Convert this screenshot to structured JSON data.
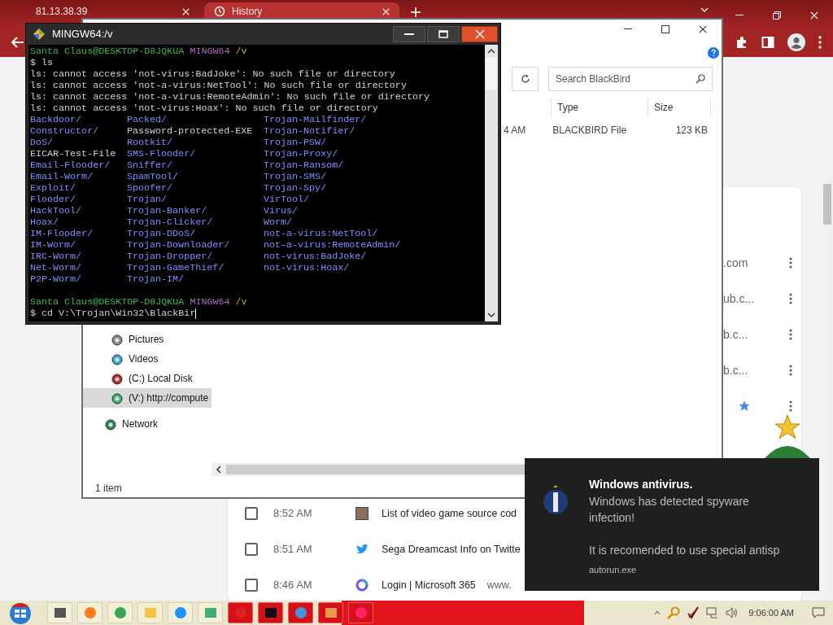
{
  "browser": {
    "tabs": [
      {
        "title": "81.13.38.39",
        "selected": false
      },
      {
        "title": "History",
        "selected": true
      }
    ],
    "url_fragments": [
      {
        "text": ".com",
        "starred": false
      },
      {
        "text": "ub.c...",
        "starred": false
      },
      {
        "text": "b.c...",
        "starred": false
      },
      {
        "text": "b.c...",
        "starred": false
      },
      {
        "starred": true
      }
    ],
    "history_rows": [
      {
        "time": "8:52 AM",
        "title": "List of video game source cod",
        "checked": false,
        "kind": "thumbnail"
      },
      {
        "time": "8:51 AM",
        "title": "Sega Dreamcast Info on Twitte",
        "checked": false,
        "kind": "bird"
      },
      {
        "time": "8:46 AM",
        "title": "Login | Microsoft 365",
        "url": "www.",
        "checked": false,
        "kind": "ring"
      }
    ]
  },
  "explorer": {
    "search": {
      "placeholder": "Search BlackBird"
    },
    "columns": [
      "Type",
      "Size"
    ],
    "files": [
      {
        "column_1": "4 AM",
        "type": "BLACKBIRD File",
        "size": "123 KB"
      }
    ],
    "nav_items": [
      {
        "label": "Pictures",
        "kind": "pictures",
        "selected": false
      },
      {
        "label": "Videos",
        "kind": "videos",
        "selected": false
      },
      {
        "label": "(C:) Local Disk",
        "kind": "disk",
        "selected": false
      },
      {
        "label": "(V:) http://compute",
        "kind": "network-drive",
        "selected": true
      },
      {
        "label": "Network",
        "kind": "network",
        "selected": false
      }
    ],
    "status_bar": "1 item"
  },
  "terminal": {
    "title": "MINGW64:/v",
    "lines_before": [
      [
        {
          "text": "Santa Claus@DESKTOP-D8JQKUA",
          "kind": "user"
        },
        {
          "text": "MINGW64",
          "kind": "system"
        },
        {
          "text": "/v",
          "kind": "path"
        }
      ],
      [
        {
          "text": "$ ls",
          "kind": "plain"
        }
      ],
      [
        {
          "text": "ls: cannot access 'not-virus:BadJoke': No such file or directory",
          "kind": "plain"
        }
      ],
      [
        {
          "text": "ls: cannot access 'not-a-virus:NetTool': No such file or directory",
          "kind": "plain"
        }
      ],
      [
        {
          "text": "ls: cannot access 'not-a-virus:RemoteAdmin': No such file or directory",
          "kind": "plain"
        }
      ],
      [
        {
          "text": "ls: cannot access 'not-virus:Hoax': No such file or directory",
          "kind": "plain"
        }
      ]
    ],
    "listing": [
      [
        {
          "name": "Backdoor/",
          "kind": "dir"
        },
        {
          "name": "Constructor/",
          "kind": "dir"
        },
        {
          "name": "DoS/",
          "kind": "dir"
        },
        {
          "name": "EICAR-Test-File",
          "kind": "file"
        },
        {
          "name": "Email-Flooder/",
          "kind": "dir"
        },
        {
          "name": "Email-Worm/",
          "kind": "dir"
        },
        {
          "name": "Exploit/",
          "kind": "dir"
        },
        {
          "name": "Flooder/",
          "kind": "dir"
        },
        {
          "name": "HackTool/",
          "kind": "dir"
        },
        {
          "name": "Hoax/",
          "kind": "dir"
        },
        {
          "name": "IM-Flooder/",
          "kind": "dir"
        },
        {
          "name": "IM-Worm/",
          "kind": "dir"
        },
        {
          "name": "IRC-Worm/",
          "kind": "dir"
        },
        {
          "name": "Net-Worm/",
          "kind": "dir"
        },
        {
          "name": "P2P-Worm/",
          "kind": "dir"
        }
      ],
      [
        {
          "name": "Packed/",
          "kind": "dir"
        },
        {
          "name": "Password-protected-EXE",
          "kind": "file"
        },
        {
          "name": "Rootkit/",
          "kind": "dir"
        },
        {
          "name": "SMS-Flooder/",
          "kind": "dir"
        },
        {
          "name": "Sniffer/",
          "kind": "dir"
        },
        {
          "name": "SpamTool/",
          "kind": "dir"
        },
        {
          "name": "Spoofer/",
          "kind": "dir"
        },
        {
          "name": "Trojan/",
          "kind": "dir"
        },
        {
          "name": "Trojan-Banker/",
          "kind": "dir"
        },
        {
          "name": "Trojan-Clicker/",
          "kind": "dir"
        },
        {
          "name": "Trojan-DDoS/",
          "kind": "dir"
        },
        {
          "name": "Trojan-Downloader/",
          "kind": "dir"
        },
        {
          "name": "Trojan-Dropper/",
          "kind": "dir"
        },
        {
          "name": "Trojan-GameThief/",
          "kind": "dir"
        },
        {
          "name": "Trojan-IM/",
          "kind": "dir"
        }
      ],
      [
        {
          "name": "Trojan-Mailfinder/",
          "kind": "dir"
        },
        {
          "name": "Trojan-Notifier/",
          "kind": "dir"
        },
        {
          "name": "Trojan-PSW/",
          "kind": "dir"
        },
        {
          "name": "Trojan-Proxy/",
          "kind": "dir"
        },
        {
          "name": "Trojan-Ransom/",
          "kind": "dir"
        },
        {
          "name": "Trojan-SMS/",
          "kind": "dir"
        },
        {
          "name": "Trojan-Spy/",
          "kind": "dir"
        },
        {
          "name": "VirTool/",
          "kind": "dir"
        },
        {
          "name": "Virus/",
          "kind": "dir"
        },
        {
          "name": "Worm/",
          "kind": "dir"
        },
        {
          "name": "not-a-virus:NetTool/",
          "kind": "dir"
        },
        {
          "name": "not-a-virus:RemoteAdmin/",
          "kind": "dir"
        },
        {
          "name": "not-virus:BadJoke/",
          "kind": "dir"
        },
        {
          "name": "not-virus:Hoax/",
          "kind": "dir"
        }
      ]
    ],
    "lines_after": [
      [
        {
          "text": "Santa Claus@DESKTOP-D8JQKUA",
          "kind": "user"
        },
        {
          "text": "MINGW64",
          "kind": "system"
        },
        {
          "text": "/v",
          "kind": "path"
        }
      ],
      [
        {
          "text": "$ cd V:\\Trojan\\Win32\\BlackBir",
          "kind": "plain"
        }
      ]
    ]
  },
  "notification": {
    "title": "Windows antivirus.",
    "message": "Windows has detected spyware infection!",
    "detail": "It is recomended to use special antisp",
    "source": "autorun.exe"
  },
  "taskbar": {
    "clock": "9:06:00 AM"
  }
}
